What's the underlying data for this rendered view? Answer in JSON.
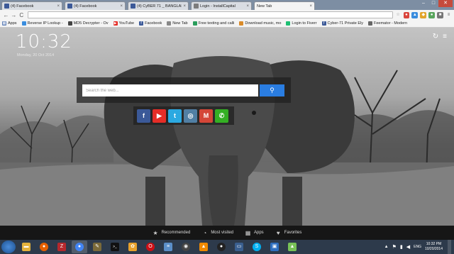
{
  "browser": {
    "tabs": [
      {
        "title": "(4) Facebook",
        "icon_color": "#3b5998",
        "active": false
      },
      {
        "title": "(4) Facebook",
        "icon_color": "#3b5998",
        "active": false
      },
      {
        "title": "(4) CyBER 71 _ BANGLADE",
        "icon_color": "#3b5998",
        "active": false
      },
      {
        "title": "Login - InstallCapital",
        "icon_color": "#7c7c7c",
        "active": false
      },
      {
        "title": "New Tab",
        "icon_color": "",
        "active": true
      }
    ],
    "window_controls": {
      "minimize": "‒",
      "maximize": "□",
      "close": "✕"
    },
    "toolbar": {
      "back": "←",
      "forward": "→",
      "reload": "C",
      "address_value": ""
    },
    "bookmarks": [
      {
        "label": "Apps",
        "icon": "apps-icon",
        "color": "#5f7fb6"
      },
      {
        "label": "Reverse IP Lookup -",
        "icon": "globe-icon",
        "color": "#3a8dde"
      },
      {
        "label": "MD5 Decrypter - Ov",
        "icon": "lock-icon",
        "color": "#444444"
      },
      {
        "label": "YouTube",
        "icon": "youtube-icon",
        "color": "#e52d27"
      },
      {
        "label": "Facebook",
        "icon": "facebook-icon",
        "color": "#3b5998"
      },
      {
        "label": "New Tab",
        "icon": "page-icon",
        "color": "#888888"
      },
      {
        "label": "Free texting and calli",
        "icon": "globe-icon",
        "color": "#2a9d5c"
      },
      {
        "label": "Download music, mo",
        "icon": "globe-icon",
        "color": "#d98b2a"
      },
      {
        "label": "Login to Fiverr",
        "icon": "fiverr-icon",
        "color": "#1dbf73"
      },
      {
        "label": "Cyber-71 Private Ely",
        "icon": "facebook-icon",
        "color": "#3b5998"
      },
      {
        "label": "Feemator - Modern",
        "icon": "globe-icon",
        "color": "#666666"
      }
    ]
  },
  "newtab": {
    "time": "10:32",
    "date": "Monday, 20 Oct 2014",
    "search_placeholder": "Search the web...",
    "search_button_icon": "search-icon",
    "social": [
      {
        "name": "facebook",
        "glyph": "f",
        "color": "#3b5998"
      },
      {
        "name": "youtube",
        "glyph": "▶",
        "color": "#e52d27"
      },
      {
        "name": "twitter",
        "glyph": "t",
        "color": "#2ba9e1"
      },
      {
        "name": "instagram",
        "glyph": "◎",
        "color": "#517fa4"
      },
      {
        "name": "gmail",
        "glyph": "M",
        "color": "#d44638"
      },
      {
        "name": "whatsapp",
        "glyph": "✆",
        "color": "#34af23"
      }
    ],
    "bottom_nav": [
      {
        "label": "Recommended",
        "icon": "★"
      },
      {
        "label": "Most visited",
        "icon": "◔"
      },
      {
        "label": "Apps",
        "icon": "▦"
      },
      {
        "label": "Favorites",
        "icon": "♥"
      }
    ]
  },
  "taskbar": {
    "apps": [
      {
        "name": "explorer",
        "glyph": "▬",
        "color": "#e3b23c"
      },
      {
        "name": "firefox",
        "glyph": "●",
        "color": "#e66000"
      },
      {
        "name": "filezilla",
        "glyph": "Z",
        "color": "#b5282d"
      },
      {
        "name": "chrome",
        "glyph": "●",
        "color": "#4285f4"
      },
      {
        "name": "pen-tool",
        "glyph": "✎",
        "color": "#7a6a3a"
      },
      {
        "name": "terminal",
        "glyph": ">_",
        "color": "#111111"
      },
      {
        "name": "paint",
        "glyph": "✿",
        "color": "#e8a22c"
      },
      {
        "name": "opera",
        "glyph": "O",
        "color": "#cc0f16"
      },
      {
        "name": "notepad",
        "glyph": "≡",
        "color": "#5b8fc9"
      },
      {
        "name": "obs",
        "glyph": "◉",
        "color": "#444444"
      },
      {
        "name": "vlc",
        "glyph": "▲",
        "color": "#f08a00"
      },
      {
        "name": "media",
        "glyph": "●",
        "color": "#222222"
      },
      {
        "name": "monitor",
        "glyph": "▭",
        "color": "#3a5f8f"
      },
      {
        "name": "skype",
        "glyph": "S",
        "color": "#00aff0"
      },
      {
        "name": "security",
        "glyph": "▣",
        "color": "#2f6fbf"
      },
      {
        "name": "android",
        "glyph": "▲",
        "color": "#78c257"
      }
    ],
    "lang": "ENG",
    "time": "10:32 PM",
    "date": "10/20/2014"
  }
}
